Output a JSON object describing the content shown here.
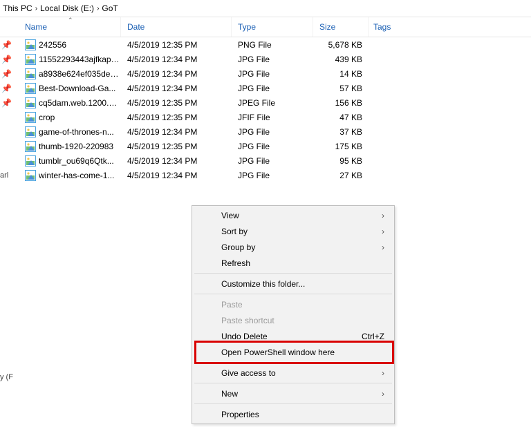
{
  "breadcrumb": {
    "a": "This PC",
    "b": "Local Disk (E:)",
    "c": "GoT"
  },
  "columns": {
    "name": "Name",
    "date": "Date",
    "type": "Type",
    "size": "Size",
    "tags": "Tags"
  },
  "files": [
    {
      "pin": true,
      "name": "242556",
      "date": "4/5/2019 12:35 PM",
      "type": "PNG File",
      "size": "5,678 KB"
    },
    {
      "pin": true,
      "name": "11552293443ajfkap7...",
      "date": "4/5/2019 12:34 PM",
      "type": "JPG File",
      "size": "439 KB"
    },
    {
      "pin": true,
      "name": "a8938e624ef035de4...",
      "date": "4/5/2019 12:34 PM",
      "type": "JPG File",
      "size": "14 KB"
    },
    {
      "pin": true,
      "name": "Best-Download-Ga...",
      "date": "4/5/2019 12:34 PM",
      "type": "JPG File",
      "size": "57 KB"
    },
    {
      "pin": true,
      "name": "cq5dam.web.1200.6...",
      "date": "4/5/2019 12:35 PM",
      "type": "JPEG File",
      "size": "156 KB"
    },
    {
      "pin": false,
      "name": "crop",
      "date": "4/5/2019 12:35 PM",
      "type": "JFIF File",
      "size": "47 KB"
    },
    {
      "pin": false,
      "name": "game-of-thrones-n...",
      "date": "4/5/2019 12:34 PM",
      "type": "JPG File",
      "size": "37 KB"
    },
    {
      "pin": false,
      "name": "thumb-1920-220983",
      "date": "4/5/2019 12:35 PM",
      "type": "JPG File",
      "size": "175 KB"
    },
    {
      "pin": false,
      "name": "tumblr_ou69q6Qtk...",
      "date": "4/5/2019 12:34 PM",
      "type": "JPG File",
      "size": "95 KB"
    },
    {
      "pin": false,
      "name": "winter-has-come-1...",
      "date": "4/5/2019 12:34 PM",
      "type": "JPG File",
      "size": "27 KB"
    }
  ],
  "left": {
    "a": "arl",
    "b": "y (F"
  },
  "menu": {
    "view": "View",
    "sortby": "Sort by",
    "groupby": "Group by",
    "refresh": "Refresh",
    "custom": "Customize this folder...",
    "paste": "Paste",
    "pastesc": "Paste shortcut",
    "undo": "Undo Delete",
    "undok": "Ctrl+Z",
    "ps": "Open PowerShell window here",
    "give": "Give access to",
    "new": "New",
    "prop": "Properties"
  }
}
